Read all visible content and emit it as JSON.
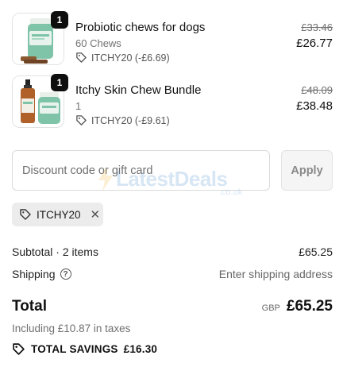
{
  "items": [
    {
      "name": "Probiotic chews for dogs",
      "subtitle": "60 Chews",
      "quantity": "1",
      "discount_text": "ITCHY20 (-£6.69)",
      "price_original": "£33.46",
      "price_final": "£26.77",
      "thumb_icon": "probiotic-jar-image"
    },
    {
      "name": "Itchy Skin Chew Bundle",
      "subtitle": "1",
      "quantity": "1",
      "discount_text": "ITCHY20 (-£9.61)",
      "price_original": "£48.09",
      "price_final": "£38.48",
      "thumb_icon": "bundle-bottle-jar-image"
    }
  ],
  "discount": {
    "placeholder": "Discount code or gift card",
    "apply_label": "Apply",
    "applied_code": "ITCHY20"
  },
  "summary": {
    "subtotal_label": "Subtotal · 2 items",
    "subtotal_value": "£65.25",
    "shipping_label": "Shipping",
    "shipping_value": "Enter shipping address",
    "total_label": "Total",
    "currency": "GBP",
    "total_value": "£65.25",
    "taxes_note": "Including £10.87 in taxes",
    "savings_label": "TOTAL SAVINGS",
    "savings_value": "£16.30"
  },
  "watermark": {
    "text": "LatestDeals",
    "sub": ".co.uk"
  },
  "colors": {
    "badge": "#0e0e0e",
    "chip_bg": "#ececec",
    "watermark": "#4e8fd0"
  }
}
